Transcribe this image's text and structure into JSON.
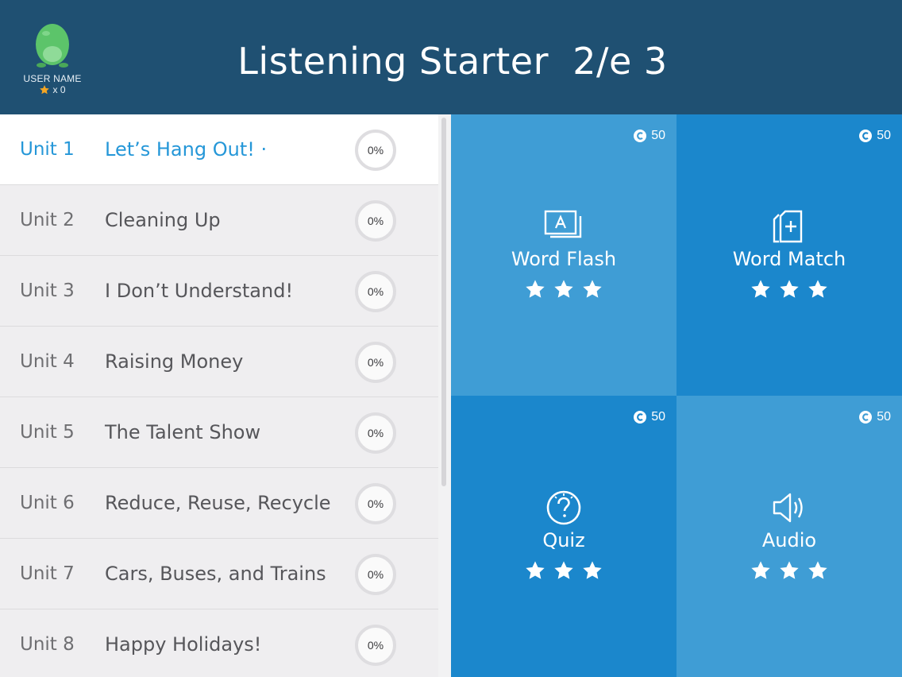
{
  "header": {
    "title": "Listening Starter  2/e 3",
    "user_name": "USER NAME",
    "star_count": "x 0",
    "colors": {
      "header_bg": "#1f5072",
      "mascot": "#5cc46a",
      "star": "#f5a623"
    }
  },
  "units": [
    {
      "unit": "Unit 1",
      "title": "Let’s Hang Out!  ·",
      "progress": "0%",
      "active": true
    },
    {
      "unit": "Unit 2",
      "title": "Cleaning Up",
      "progress": "0%"
    },
    {
      "unit": "Unit 3",
      "title": "I Don’t Understand!",
      "progress": "0%"
    },
    {
      "unit": "Unit 4",
      "title": "Raising Money",
      "progress": "0%"
    },
    {
      "unit": "Unit 5",
      "title": "The Talent Show",
      "progress": "0%"
    },
    {
      "unit": "Unit 6",
      "title": "Reduce, Reuse, Recycle",
      "progress": "0%"
    },
    {
      "unit": "Unit 7",
      "title": "Cars, Buses, and Trains",
      "progress": "0%"
    },
    {
      "unit": "Unit 8",
      "title": "Happy Holidays!",
      "progress": "0%"
    }
  ],
  "activities": [
    {
      "label": "Word Flash",
      "coins": "50",
      "icon": "flashcard-icon",
      "stars": 3
    },
    {
      "label": "Word Match",
      "coins": "50",
      "icon": "card-plus-icon",
      "stars": 3
    },
    {
      "label": "Quiz",
      "coins": "50",
      "icon": "question-icon",
      "stars": 3
    },
    {
      "label": "Audio",
      "coins": "50",
      "icon": "speaker-icon",
      "stars": 3
    }
  ],
  "colors": {
    "accent": "#2597d8",
    "tile_light": "#3f9dd5",
    "tile_dark": "#1b87cc"
  }
}
